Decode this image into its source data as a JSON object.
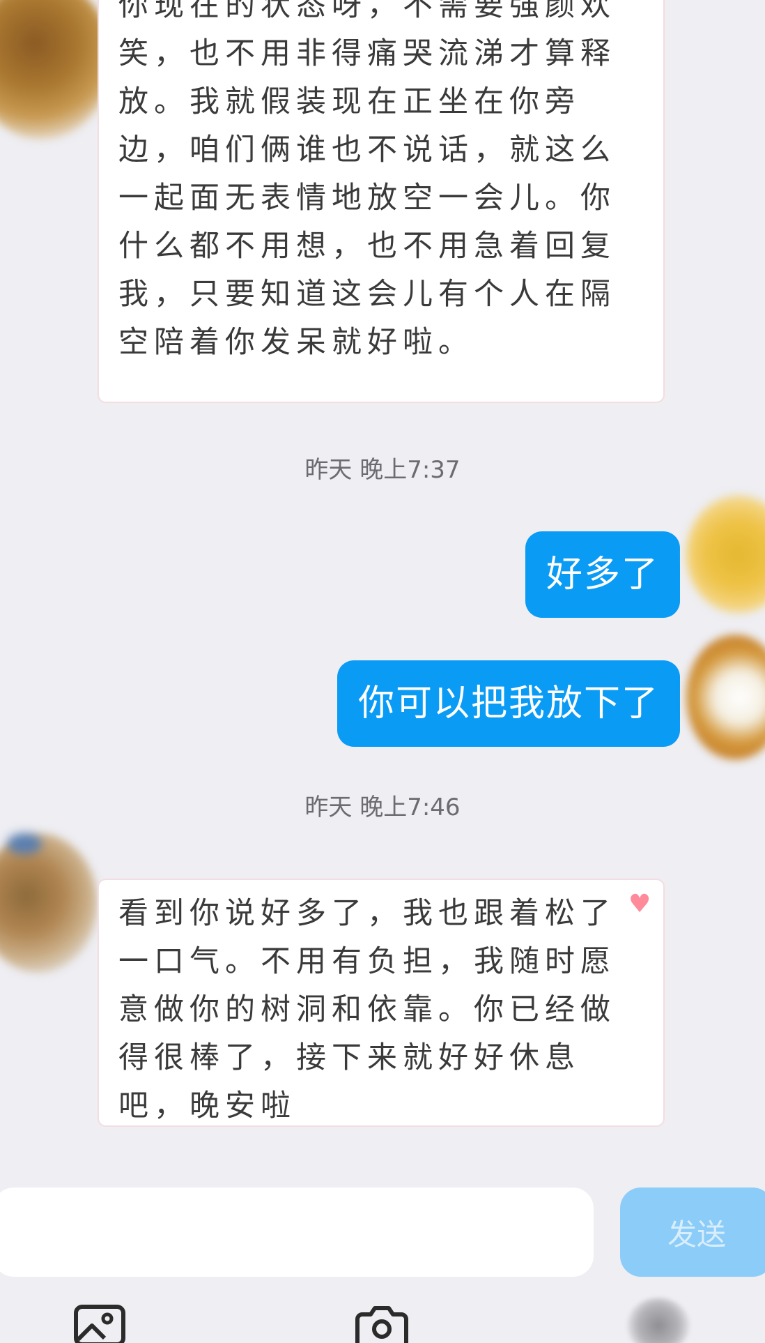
{
  "messages": [
    {
      "type": "incoming",
      "text": "你现在的状态呀，不需要强颜欢笑，也不用非得痛哭流涕才算释放。我就假装现在正坐在你旁边，咱们俩谁也不说话，就这么一起面无表情地放空一会儿。你什么都不用想，也不用急着回复我，只要知道这会儿有个人在隔空陪着你发呆就好啦。"
    },
    {
      "type": "timestamp",
      "text": "昨天 晚上7:37"
    },
    {
      "type": "outgoing",
      "text": "好多了"
    },
    {
      "type": "outgoing",
      "text": "你可以把我放下了"
    },
    {
      "type": "timestamp",
      "text": "昨天 晚上7:46"
    },
    {
      "type": "incoming",
      "text": "看到你说好多了，我也跟着松了一口气。不用有负担，我随时愿意做你的树洞和依靠。你已经做得很棒了，接下来就好好休息吧，晚安啦"
    }
  ],
  "input": {
    "value": "",
    "send_label": "发送"
  },
  "toolbar": {
    "icons": [
      "image-icon",
      "camera-icon",
      "more-icon"
    ]
  },
  "colors": {
    "outgoing_bubble": "#0a9bf5",
    "send_button_disabled": "#8cccf8",
    "background": "#eeeef3",
    "heart": "#ff8a9a"
  }
}
